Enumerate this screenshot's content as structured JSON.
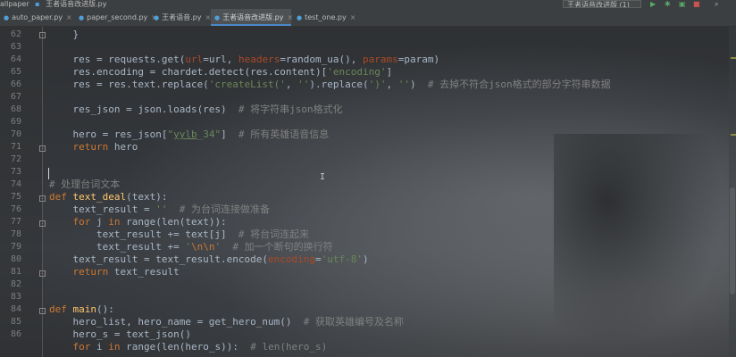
{
  "toolbar": {
    "crumbs": [
      "allpaper",
      "王者语音改进版.py"
    ],
    "run_config": "王者语音改进版 (1)",
    "run_icon": "▶",
    "debug_icon": "✱",
    "coverage_icon": "▣",
    "stop_icon": "■",
    "search_icon": "⌕"
  },
  "tabs": [
    {
      "label": "auto_paper.py",
      "close": "×"
    },
    {
      "label": "paper_second.py",
      "close": "×"
    },
    {
      "label": "王者语音.py",
      "close": "×"
    },
    {
      "label": "王者语音改进版.py",
      "close": "×"
    },
    {
      "label": "test_one.py",
      "close": "×"
    }
  ],
  "editor": {
    "line_numbers": [
      "62",
      "63",
      "64",
      "65",
      "66",
      "67",
      "68",
      "69",
      "70",
      "71",
      "72",
      "73",
      "74",
      "75",
      "76",
      "77",
      "78",
      "79",
      "80",
      "81",
      "82",
      "83",
      "84",
      "85",
      "86"
    ],
    "lines": {
      "l62": "    }",
      "l65": "    res = requests.get(url=url, headers=random_ua(), params=param)",
      "l66": "    res.encoding = chardet.detect(res.content)['encoding']",
      "l67": "    res = res.text.replace('createList(', '').replace(')', '')  # 去掉不符合json格式的部分字符串数据",
      "l69": "    res_json = json.loads(res)  # 将字符串json格式化",
      "l71": "    hero = res_json[\"yylb_34\"]  # 所有英雄语音信息",
      "l72": "    return hero",
      "l75": "# 处理台词文本",
      "l76": "def text_deal(text):",
      "l77": "    text_result = ''  # 为台词连接做准备",
      "l78": "    for j in range(len(text)):",
      "l79": "        text_result += text[j]  # 将台词连起来",
      "l80": "        text_result += '\\n\\n'  # 加一个断句的换行符",
      "l81": "    text_result = text_result.encode(encoding='utf-8')",
      "l82": "    return text_result",
      "l85": "def main():",
      "l86": "    hero_list, hero_name = get_hero_num()  # 获取英雄编号及名称",
      "l87": "    hero_s = text_json()",
      "l88": "    for i in range(len(hero_s)):  # len(hero_s)"
    }
  },
  "colors": {
    "keyword": "#cc7832",
    "function": "#ffc66d",
    "string": "#6a8759",
    "comment": "#808080",
    "param": "#aa4926",
    "default": "#a9b7c6"
  }
}
